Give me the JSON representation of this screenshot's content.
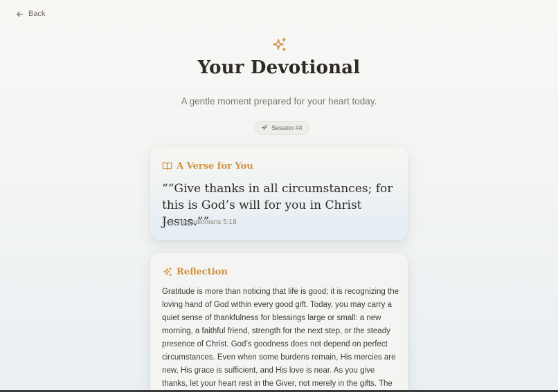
{
  "nav": {
    "back_label": "Back",
    "back_icon": "arrow-left-icon"
  },
  "header": {
    "icon": "sparkles-icon",
    "title": "Your Devotional",
    "subtitle": "A gentle moment prepared for your heart today.",
    "session_label": "Session #4"
  },
  "verse": {
    "icon": "book-open-icon",
    "heading": "A Verse for You",
    "text": "““Give thanks in all circumstances; for this is God’s will for you in Christ Jesus.””",
    "reference": "— 1 Thessalonians 5:18"
  },
  "reflection": {
    "icon": "sparkles-icon",
    "heading": "Reflection",
    "text": "Gratitude is more than noticing that life is good; it is recognizing the loving hand of God within every good gift. Today, you may carry a quiet sense of thankfulness for blessings large or small: a new morning, a faithful friend, strength for the next step, or the steady presence of Christ. God’s goodness does not depend on perfect circumstances. Even when some burdens remain, His mercies are new, His grace is sufficient, and His love is near. As you give thanks, let your heart rest in the Giver, not merely in the gifts. The Father"
  },
  "colors": {
    "accent": "#d0913a",
    "title": "#2d2a26",
    "muted": "#7a756e"
  }
}
